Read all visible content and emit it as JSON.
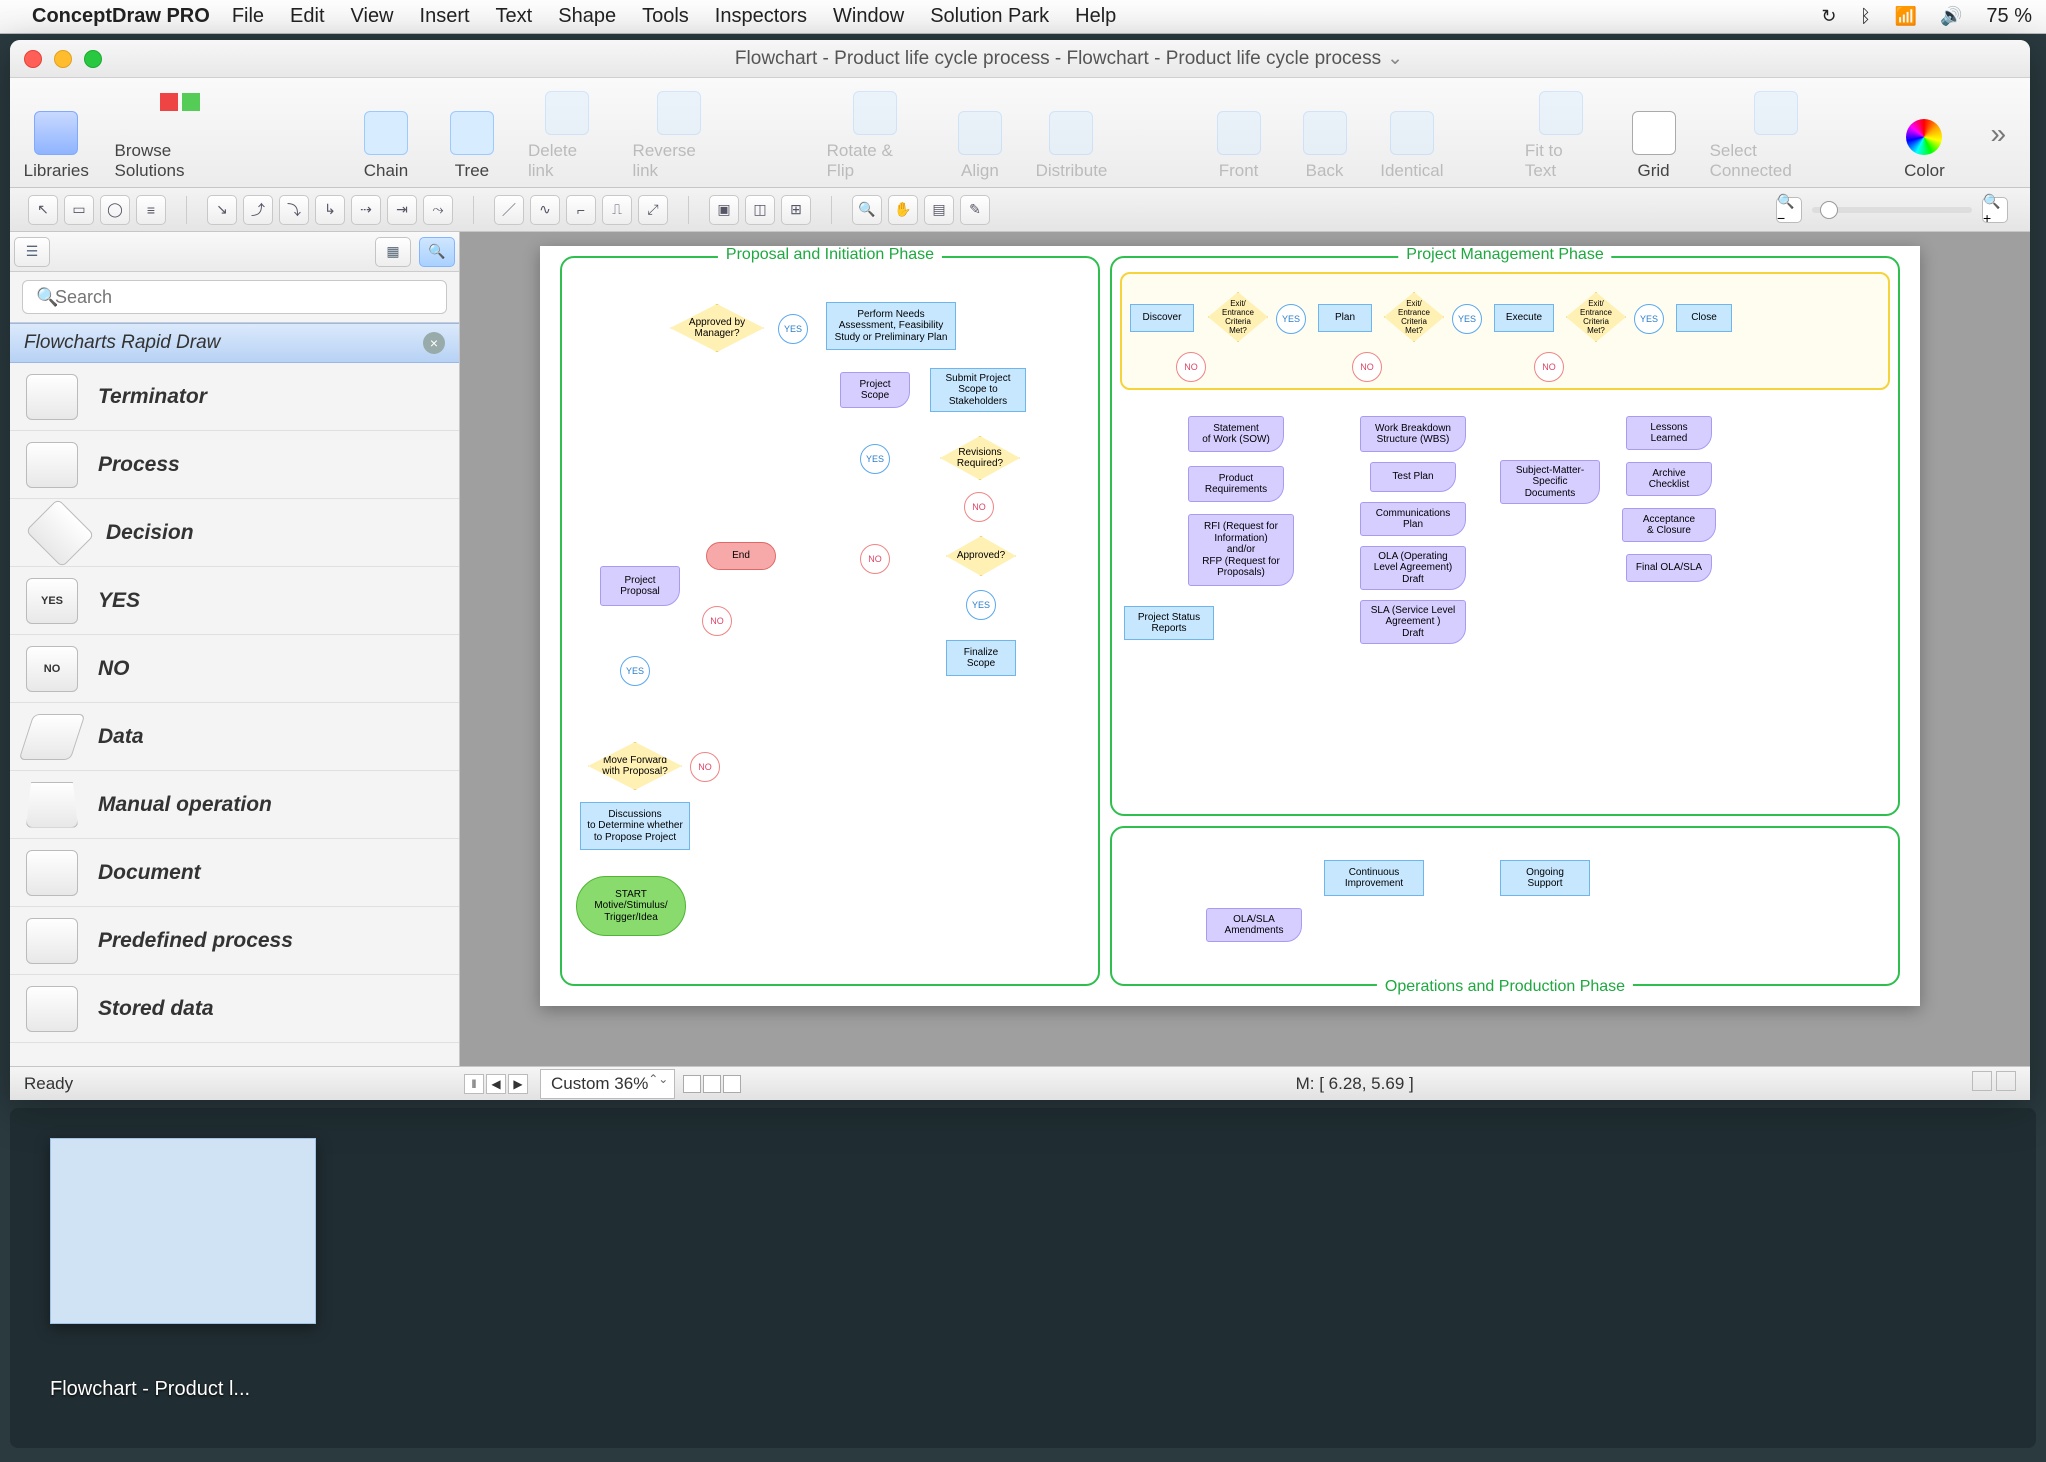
{
  "menubar": {
    "app": "ConceptDraw PRO",
    "items": [
      "File",
      "Edit",
      "View",
      "Insert",
      "Text",
      "Shape",
      "Tools",
      "Inspectors",
      "Window",
      "Solution Park",
      "Help"
    ],
    "battery": "75 %"
  },
  "window": {
    "title": "Flowchart - Product life cycle process - Flowchart - Product life cycle process"
  },
  "toolbar": {
    "libraries": "Libraries",
    "browse": "Browse Solutions",
    "chain": "Chain",
    "tree": "Tree",
    "delete_link": "Delete link",
    "reverse_link": "Reverse link",
    "rotate_flip": "Rotate & Flip",
    "align": "Align",
    "distribute": "Distribute",
    "front": "Front",
    "back": "Back",
    "identical": "Identical",
    "fit": "Fit to Text",
    "grid": "Grid",
    "select_connected": "Select Connected",
    "color": "Color"
  },
  "sidebar": {
    "search_placeholder": "Search",
    "header": "Flowcharts Rapid Draw",
    "stencils": [
      "Terminator",
      "Process",
      "Decision",
      "YES",
      "NO",
      "Data",
      "Manual operation",
      "Document",
      "Predefined process",
      "Stored data"
    ]
  },
  "flowchart": {
    "phase1": "Proposal and Initiation Phase",
    "phase2": "Project Management Phase",
    "phase3": "Operations and Production Phase",
    "start": "START\nMotive/Stimulus/\nTrigger/Idea",
    "discussions": "Discussions\nto Determine whether\nto Propose Project",
    "move_forward": "Move Forward\nwith Proposal?",
    "proposal": "Project\nProposal",
    "approved_mgr": "Approved by\nManager?",
    "perform_needs": "Perform Needs\nAssessment, Feasibility\nStudy or Preliminary Plan",
    "project_scope": "Project\nScope",
    "submit_scope": "Submit Project\nScope to\nStakeholders",
    "revisions": "Revisions\nRequired?",
    "approved": "Approved?",
    "finalize": "Finalize\nScope",
    "end": "End",
    "discover": "Discover",
    "plan": "Plan",
    "execute": "Execute",
    "close": "Close",
    "exit_criteria": "Exit/\nEntrance\nCriteria\nMet?",
    "status_reports": "Project Status\nReports",
    "sow": "Statement\nof Work (SOW)",
    "prod_req": "Product\nRequirements",
    "rfi": "RFI (Request for\nInformation)\nand/or\nRFP (Request for\nProposals)",
    "wbs": "Work Breakdown\nStructure (WBS)",
    "test_plan": "Test Plan",
    "comm_plan": "Communications\nPlan",
    "ola": "OLA (Operating\nLevel Agreement)\nDraft",
    "sla": "SLA (Service Level\nAgreement )\nDraft",
    "sme": "Subject-Matter-\nSpecific\nDocuments",
    "lessons": "Lessons\nLearned",
    "archive": "Archive\nChecklist",
    "acceptance": "Acceptance\n& Closure",
    "final_ola": "Final OLA/SLA",
    "cont_improve": "Continuous\nImprovement",
    "ongoing": "Ongoing\nSupport",
    "ola_amend": "OLA/SLA\nAmendments",
    "yes": "YES",
    "no": "NO"
  },
  "status": {
    "ready": "Ready",
    "zoom": "Custom 36%",
    "coord": "M: [ 6.28, 5.69 ]"
  },
  "dock": {
    "label": "Flowchart - Product l..."
  }
}
